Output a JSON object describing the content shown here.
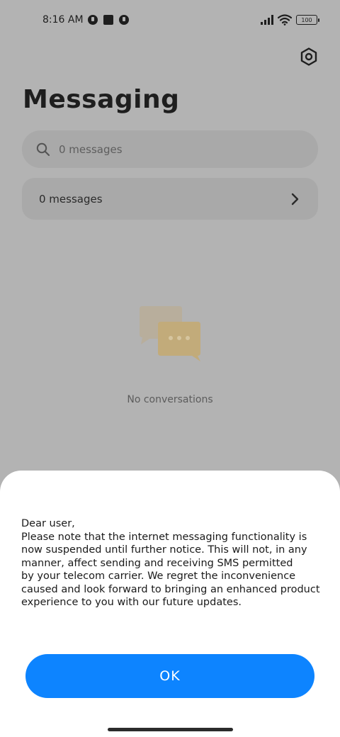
{
  "status_bar": {
    "time": "8:16 AM",
    "battery": "100",
    "icons": [
      "notification-icon",
      "square-notification-icon",
      "notification-icon",
      "signal-icon",
      "wifi-icon",
      "battery-icon"
    ]
  },
  "header": {
    "title": "Messaging",
    "settings_icon": "settings-icon"
  },
  "search": {
    "placeholder": "0 messages",
    "icon": "search-icon"
  },
  "messages_row": {
    "label": "0 messages",
    "icon": "chevron-right-icon"
  },
  "empty_state": {
    "text": "No conversations",
    "icon": "chat-bubbles-icon"
  },
  "dialog": {
    "greeting": "Dear user,",
    "lines": [
      "Please note that the internet messaging functionality is",
      "now suspended until further notice. This will not, in any",
      "manner, affect sending and receiving SMS permitted",
      "by your telecom carrier. We regret the inconvenience",
      "caused and look forward to bringing an enhanced product",
      "experience to you with our future updates."
    ],
    "ok_label": "OK"
  },
  "colors": {
    "accent": "#0d84ff",
    "overlay_background": "#b3b3b3",
    "sheet_background": "#ffffff"
  }
}
